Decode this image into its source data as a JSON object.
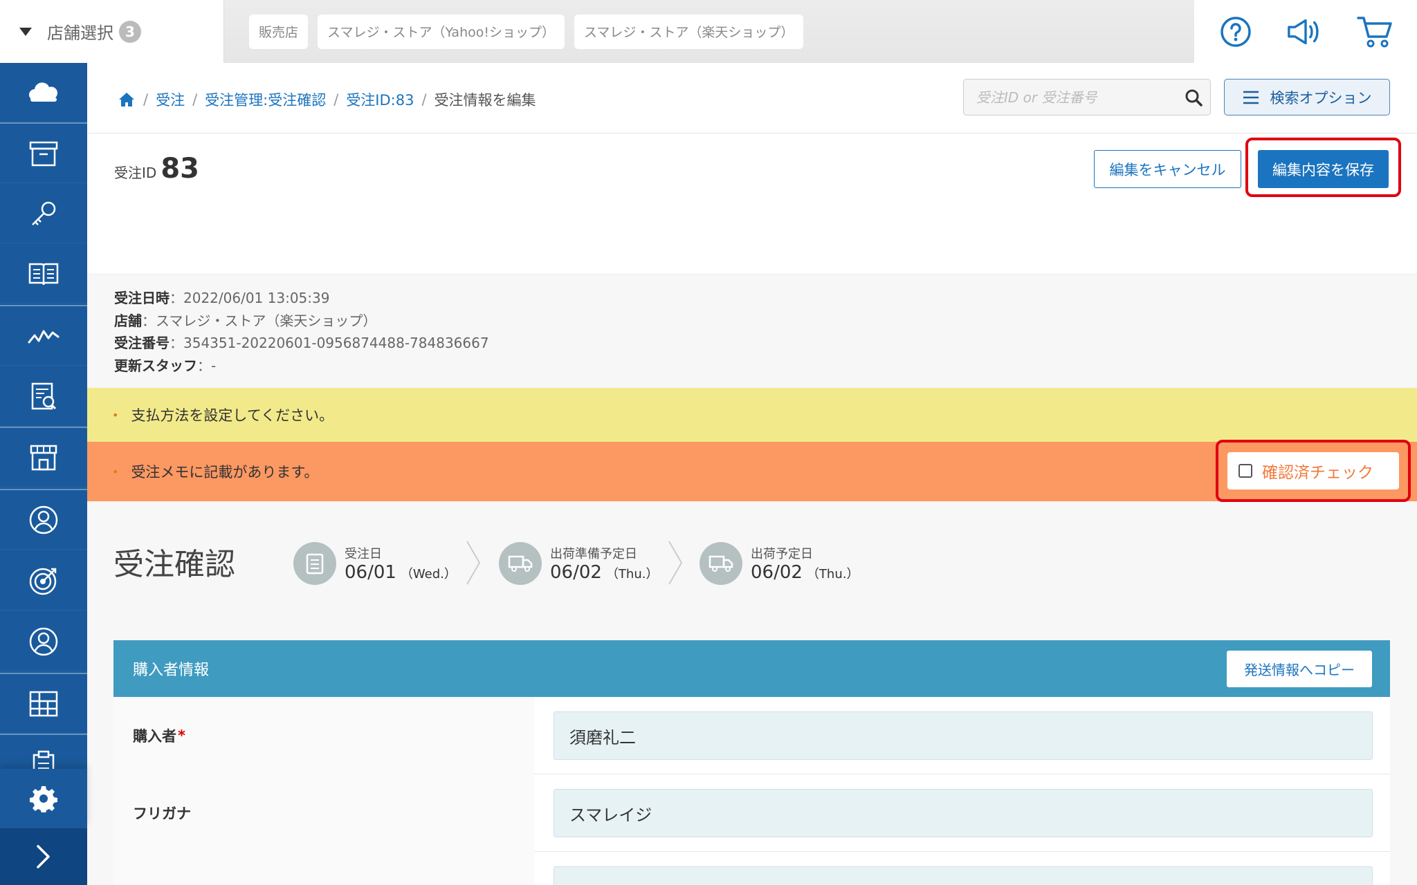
{
  "topbar": {
    "store_select_label": "店舗選択",
    "store_count": "3",
    "store_tabs": [
      "販売店",
      "スマレジ・ストア（Yahoo!ショップ）",
      "スマレジ・ストア（楽天ショップ）"
    ],
    "icons": [
      "help-icon",
      "announcement-icon",
      "cart-icon"
    ]
  },
  "sidebar": {
    "items": [
      "cloud-icon",
      "archive-icon",
      "key-icon",
      "book-icon",
      "analytics-icon",
      "report-icon",
      "store-icon",
      "customer-icon",
      "target-icon",
      "staff-icon",
      "grid-icon",
      "clipboard-icon"
    ],
    "bottom": [
      "gear-icon",
      "chevron-right-icon"
    ]
  },
  "breadcrumb": {
    "items": [
      "受注",
      "受注管理:受注確認",
      "受注ID:83"
    ],
    "current": "受注情報を編集"
  },
  "search": {
    "placeholder": "受注ID or 受注番号",
    "options_label": "検索オプション"
  },
  "order": {
    "id_label": "受注ID",
    "id_value": "83",
    "cancel_label": "編集をキャンセル",
    "save_label": "編集内容を保存"
  },
  "meta": {
    "date_label": "受注日時",
    "date_value": "：2022/06/01 13:05:39",
    "store_label": "店舗",
    "store_value": "：スマレジ・ストア（楽天ショップ）",
    "number_label": "受注番号",
    "number_value": "：354351-20220601-0956874488-784836667",
    "staff_label": "更新スタッフ",
    "staff_value": "：-"
  },
  "alerts": {
    "payment": "支払方法を設定してください。",
    "memo": "受注メモに記載があります。",
    "confirm_check": "確認済チェック"
  },
  "status": {
    "title": "受注確認",
    "steps": [
      {
        "label": "受注日",
        "date": "06/01",
        "weekday": "（Wed.）"
      },
      {
        "label": "出荷準備予定日",
        "date": "06/02",
        "weekday": "（Thu.）"
      },
      {
        "label": "出荷予定日",
        "date": "06/02",
        "weekday": "（Thu.）"
      }
    ]
  },
  "buyer": {
    "header": "購入者情報",
    "copy_label": "発送情報へコピー",
    "name_label": "購入者",
    "name_required": "*",
    "name_value": "須磨礼二",
    "kana_label": "フリガナ",
    "kana_value": "スマレイジ"
  },
  "colors": {
    "sidebar": "#1a5a9c",
    "primary": "#1b74bf",
    "alert_yellow": "#f2ea8a",
    "alert_orange": "#fc9862",
    "highlight": "#e00011",
    "card_header": "#3f9bbf"
  }
}
